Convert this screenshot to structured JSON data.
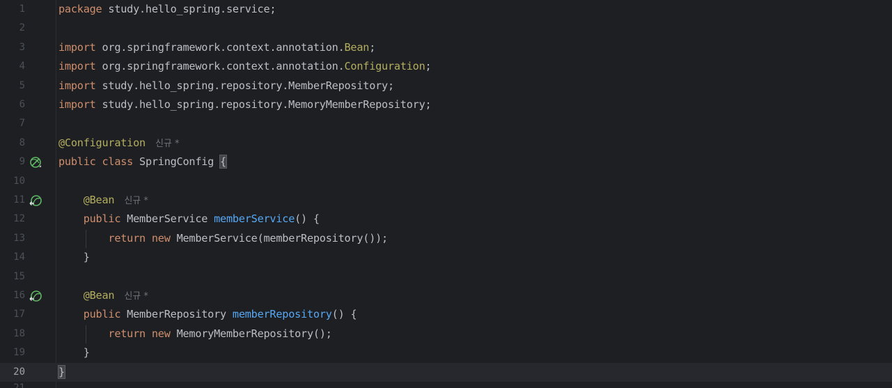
{
  "editor": {
    "current_line": 20,
    "colors": {
      "background": "#1e1f22",
      "keyword": "#cf8e6d",
      "annotation": "#b3ae60",
      "method": "#56a8f5",
      "text": "#bcbec4"
    },
    "lines": [
      {
        "num": "1",
        "t": [
          {
            "c": "kw",
            "v": "package"
          },
          {
            "c": "",
            "v": " study.hello_spring.service;"
          }
        ]
      },
      {
        "num": "2",
        "t": []
      },
      {
        "num": "3",
        "t": [
          {
            "c": "kw",
            "v": "import"
          },
          {
            "c": "",
            "v": " org.springframework.context.annotation."
          },
          {
            "c": "ann",
            "v": "Bean"
          },
          {
            "c": "",
            "v": ";"
          }
        ]
      },
      {
        "num": "4",
        "t": [
          {
            "c": "kw",
            "v": "import"
          },
          {
            "c": "",
            "v": " org.springframework.context.annotation."
          },
          {
            "c": "ann",
            "v": "Configuration"
          },
          {
            "c": "",
            "v": ";"
          }
        ]
      },
      {
        "num": "5",
        "t": [
          {
            "c": "kw",
            "v": "import"
          },
          {
            "c": "",
            "v": " study.hello_spring.repository.MemberRepository;"
          }
        ]
      },
      {
        "num": "6",
        "t": [
          {
            "c": "kw",
            "v": "import"
          },
          {
            "c": "",
            "v": " study.hello_spring.repository.MemoryMemberRepository;"
          }
        ]
      },
      {
        "num": "7",
        "t": []
      },
      {
        "num": "8",
        "t": [
          {
            "c": "ann",
            "v": "@Configuration"
          },
          {
            "c": "hint",
            "v": "신규 *"
          }
        ]
      },
      {
        "num": "9",
        "icon": "bean-config-icon",
        "t": [
          {
            "c": "kw",
            "v": "public class"
          },
          {
            "c": "",
            "v": " SpringConfig "
          },
          {
            "c": "brace-hl",
            "v": "{"
          }
        ]
      },
      {
        "num": "10",
        "t": []
      },
      {
        "num": "11",
        "icon": "bean-method-icon",
        "t": [
          {
            "c": "",
            "v": "    "
          },
          {
            "c": "ann",
            "v": "@Bean"
          },
          {
            "c": "hint",
            "v": "신규 *"
          }
        ]
      },
      {
        "num": "12",
        "t": [
          {
            "c": "",
            "v": "    "
          },
          {
            "c": "kw",
            "v": "public"
          },
          {
            "c": "",
            "v": " MemberService "
          },
          {
            "c": "fn",
            "v": "memberService"
          },
          {
            "c": "",
            "v": "() {"
          }
        ]
      },
      {
        "num": "13",
        "t": [
          {
            "c": "",
            "v": "        "
          },
          {
            "c": "kw",
            "v": "return new"
          },
          {
            "c": "",
            "v": " MemberService(memberRepository());"
          }
        ]
      },
      {
        "num": "14",
        "t": [
          {
            "c": "",
            "v": "    }"
          }
        ]
      },
      {
        "num": "15",
        "t": []
      },
      {
        "num": "16",
        "icon": "bean-method-icon",
        "t": [
          {
            "c": "",
            "v": "    "
          },
          {
            "c": "ann",
            "v": "@Bean"
          },
          {
            "c": "hint",
            "v": "신규 *"
          }
        ]
      },
      {
        "num": "17",
        "t": [
          {
            "c": "",
            "v": "    "
          },
          {
            "c": "kw",
            "v": "public"
          },
          {
            "c": "",
            "v": " MemberRepository "
          },
          {
            "c": "fn",
            "v": "memberRepository"
          },
          {
            "c": "",
            "v": "() {"
          }
        ]
      },
      {
        "num": "18",
        "t": [
          {
            "c": "",
            "v": "        "
          },
          {
            "c": "kw",
            "v": "return new"
          },
          {
            "c": "",
            "v": " MemoryMemberRepository();"
          }
        ]
      },
      {
        "num": "19",
        "t": [
          {
            "c": "",
            "v": "    }"
          }
        ]
      },
      {
        "num": "20",
        "t": [
          {
            "c": "brace-hl",
            "v": "}"
          }
        ]
      }
    ]
  }
}
